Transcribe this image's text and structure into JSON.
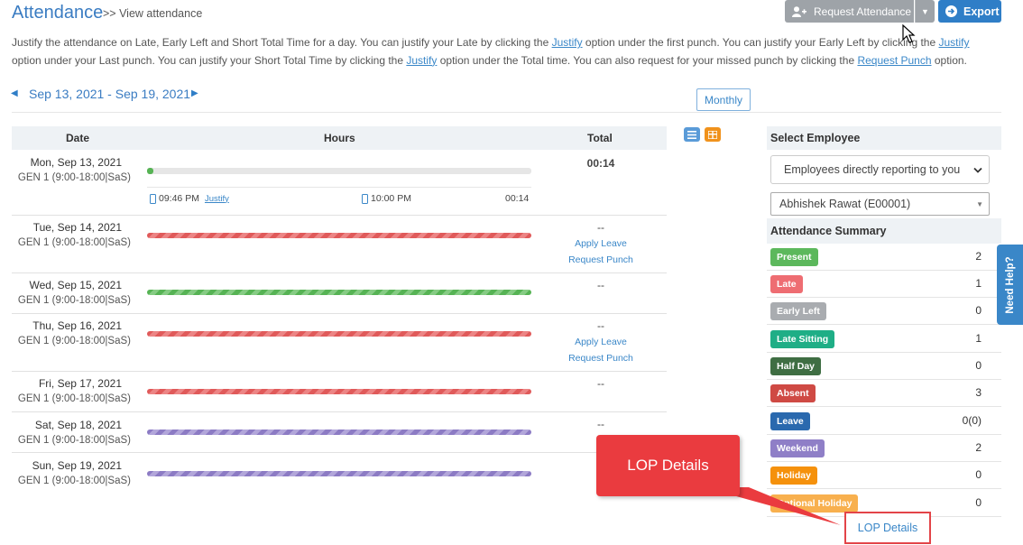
{
  "header": {
    "title": "Attendance",
    "breadcrumb": ">> View attendance",
    "request_btn": "Request Attendance",
    "export_btn": "Export"
  },
  "instructions": {
    "p1": "Justify the attendance on Late, Early Left and Short Total Time for a day. You can justify your Late by clicking the ",
    "l1": "Justify",
    "p2": " option under the first punch. You can justify your Early Left by clicking the ",
    "l2": "Justify",
    "p3": " option under your Last punch. You can justify your Short Total Time by clicking the ",
    "l3": "Justify",
    "p4": " option under the Total time. You can also request for your missed punch by clicking the ",
    "l4": "Request Punch",
    "p5": " option."
  },
  "week": {
    "label": "Sep 13, 2021 - Sep 19, 2021"
  },
  "view": {
    "monthly": "Monthly"
  },
  "table": {
    "headers": {
      "date": "Date",
      "hours": "Hours",
      "total": "Total"
    },
    "rows": [
      {
        "date": "Mon, Sep 13, 2021",
        "shift": "GEN 1 (9:00-18:00|SaS)",
        "total": "00:14",
        "in_time": "09:46 PM",
        "justify": "Justify",
        "out_time": "10:00 PM",
        "duration": "00:14"
      },
      {
        "date": "Tue, Sep 14, 2021",
        "shift": "GEN 1 (9:00-18:00|SaS)",
        "total": "--",
        "apply_leave": "Apply Leave",
        "request_punch": "Request Punch"
      },
      {
        "date": "Wed, Sep 15, 2021",
        "shift": "GEN 1 (9:00-18:00|SaS)",
        "total": "--"
      },
      {
        "date": "Thu, Sep 16, 2021",
        "shift": "GEN 1 (9:00-18:00|SaS)",
        "total": "--",
        "apply_leave": "Apply Leave",
        "request_punch": "Request Punch"
      },
      {
        "date": "Fri, Sep 17, 2021",
        "shift": "GEN 1 (9:00-18:00|SaS)",
        "total": "--"
      },
      {
        "date": "Sat, Sep 18, 2021",
        "shift": "GEN 1 (9:00-18:00|SaS)",
        "total": "--"
      },
      {
        "date": "Sun, Sep 19, 2021",
        "shift": "GEN 1 (9:00-18:00|SaS)",
        "total": ""
      }
    ]
  },
  "right_panel": {
    "select_employee_title": "Select Employee",
    "employee_filter": "Employees directly reporting to you",
    "employee": "Abhishek Rawat (E00001)",
    "summary_title": "Attendance Summary",
    "summary": [
      {
        "label": "Present",
        "value": "2",
        "color": "#5cb85c"
      },
      {
        "label": "Late",
        "value": "1",
        "color": "#ee6d72"
      },
      {
        "label": "Early Left",
        "value": "0",
        "color": "#a9acb0"
      },
      {
        "label": "Late Sitting",
        "value": "1",
        "color": "#1fae86"
      },
      {
        "label": "Half Day",
        "value": "0",
        "color": "#3f6e43"
      },
      {
        "label": "Absent",
        "value": "3",
        "color": "#cf4a44"
      },
      {
        "label": "Leave",
        "value": "0(0)",
        "color": "#2a69ae"
      },
      {
        "label": "Weekend",
        "value": "2",
        "color": "#8f7fc7"
      },
      {
        "label": "Holiday",
        "value": "0",
        "color": "#f5910c"
      },
      {
        "label": "Optional Holiday",
        "value": "0",
        "color": "#f8b04e"
      }
    ],
    "lop_link": "LOP Details"
  },
  "need_help": "Need Help?",
  "callout": {
    "text": "LOP Details"
  }
}
